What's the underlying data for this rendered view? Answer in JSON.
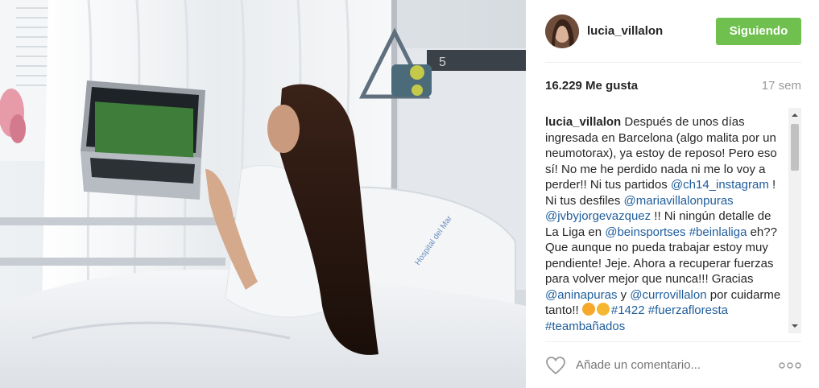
{
  "photo": {
    "alt_visible": "",
    "bed_number": "5",
    "pillow_text": "Hospital del Mar"
  },
  "post": {
    "username": "lucia_villalon",
    "follow_label": "Siguiendo",
    "likes": "16.229 Me gusta",
    "time_ago": "17 sem"
  },
  "caption": {
    "username": "lucia_villalon",
    "t1": " Después de unos días ingresada en Barcelona (algo malita por un neumotorax), ya estoy de reposo! Pero eso sí! No me he perdido nada ni me lo voy a perder!! Ni tus partidos ",
    "m1": "@ch14_instagram",
    "t2": " ! Ni tus desfiles ",
    "m2": "@mariavillalonpuras",
    "t3": " ",
    "m3": "@jvbyjorgevazquez",
    "t4": " !! Ni ningún detalle de La Liga en ",
    "m4": "@beinsportses",
    "t5": " ",
    "h1": "#beinlaliga",
    "t6": " eh?? Que aunque no pueda trabajar estoy muy pendiente! Jeje. Ahora a recuperar fuerzas para volver mejor que nunca!!! Gracias ",
    "m5": "@aninapuras",
    "t7": " y ",
    "m6": "@currovillalon",
    "t8": " por cuidarme tanto!! ",
    "h2": "#1422",
    "t9": " ",
    "h3": "#fuerzafloresta",
    "t10": " ",
    "h4": "#teambañados"
  },
  "footer": {
    "comment_placeholder": "Añade un comentario..."
  },
  "colors": {
    "follow_bg": "#70c050",
    "link": "#1e5d9c",
    "muted": "#999999"
  },
  "icons": {
    "like": "heart-outline-icon",
    "more": "more-options-icon",
    "scroll_up": "scroll-up-arrow-icon",
    "scroll_down": "scroll-down-arrow-icon"
  }
}
